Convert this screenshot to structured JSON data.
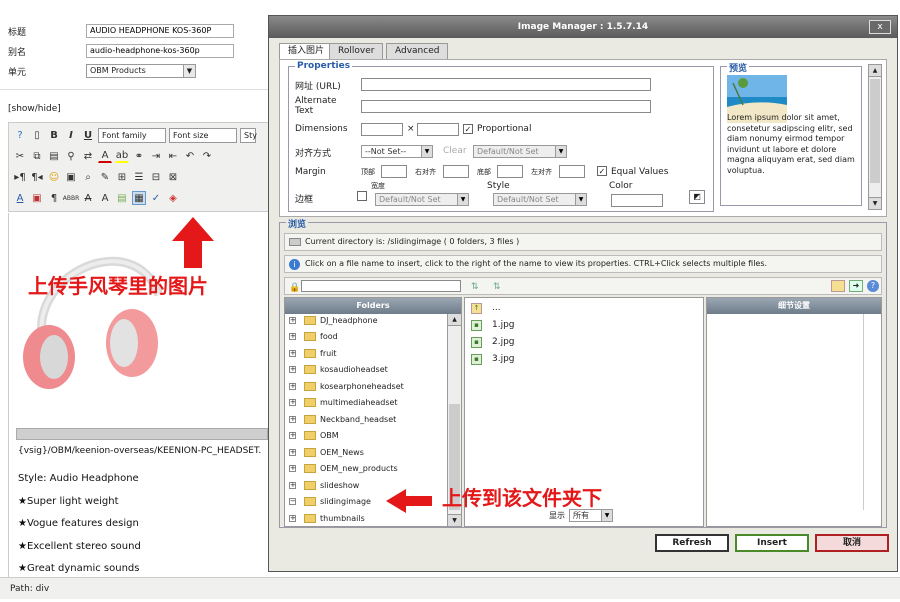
{
  "form": {
    "title_label": "标题",
    "title_value": "AUDIO HEADPHONE KOS-360P",
    "alias_label": "别名",
    "alias_value": "audio-headphone-kos-360p",
    "unit_label": "单元",
    "unit_value": "OBM Products"
  },
  "editor": {
    "show_hide": "[show/hide]",
    "font_family": "Font family",
    "font_size": "Font size",
    "style_partial": "Sty",
    "annotation_upload": "上传手风琴里的图片",
    "image_path": "{vsig}/OBM/keenion-overseas/KEENION-PC_HEADSET.",
    "lines": [
      "Style: Audio Headphone",
      "★Super light weight",
      "★Vogue features design",
      "★Excellent stereo sound",
      "★Great dynamic sounds"
    ],
    "path": "Path: div"
  },
  "dialog": {
    "title": "Image Manager : 1.5.7.14",
    "close": "x",
    "tabs": [
      "插入图片",
      "Rollover",
      "Advanced"
    ],
    "properties": {
      "legend": "Properties",
      "url_label": "网址 (URL)",
      "alt_label": "Alternate Text",
      "dimensions_label": "Dimensions",
      "times": "×",
      "proportional": "Proportional",
      "align_label": "对齐方式",
      "align_value": "--Not Set--",
      "clear_label": "Clear",
      "clear_value": "Default/Not Set",
      "margin_label": "Margin",
      "top": "顶部",
      "right": "右对齐",
      "bottom": "底部",
      "left": "左对齐",
      "equal_values": "Equal Values",
      "border_label": "边框",
      "width_label": "宽度",
      "style_label": "Style",
      "color_label": "Color",
      "border_default": "Default/Not Set",
      "style_default": "Default/Not Set"
    },
    "preview": {
      "legend": "预览",
      "text": "Lorem ipsum dolor sit amet, consetetur sadipscing elitr, sed diam nonumy eirmod tempor invidunt ut labore et dolore magna aliquyam erat, sed diam voluptua."
    },
    "browse": {
      "legend": "浏览",
      "directory": "Current directory is: /slidingimage ( 0 folders, 3 files )",
      "info": "Click on a file name to insert, click to the right of the name to view its properties. CTRL+Click selects multiple files.",
      "folders_header": "Folders",
      "details_header": "细节设置",
      "folders": [
        "DJ_headphone",
        "food",
        "fruit",
        "kosaudioheadset",
        "kosearphoneheadset",
        "multimediaheadset",
        "Neckband_headset",
        "OBM",
        "OEM_News",
        "OEM_new_products",
        "slideshow",
        "slidingimage",
        "thumbnails"
      ],
      "up": "...",
      "files": [
        "1.jpg",
        "2.jpg",
        "3.jpg"
      ],
      "show_label": "显示",
      "show_value": "所有",
      "annotation_folder": "上传到该文件夹下"
    },
    "buttons": {
      "refresh": "Refresh",
      "insert": "Insert",
      "cancel": "取消"
    }
  }
}
